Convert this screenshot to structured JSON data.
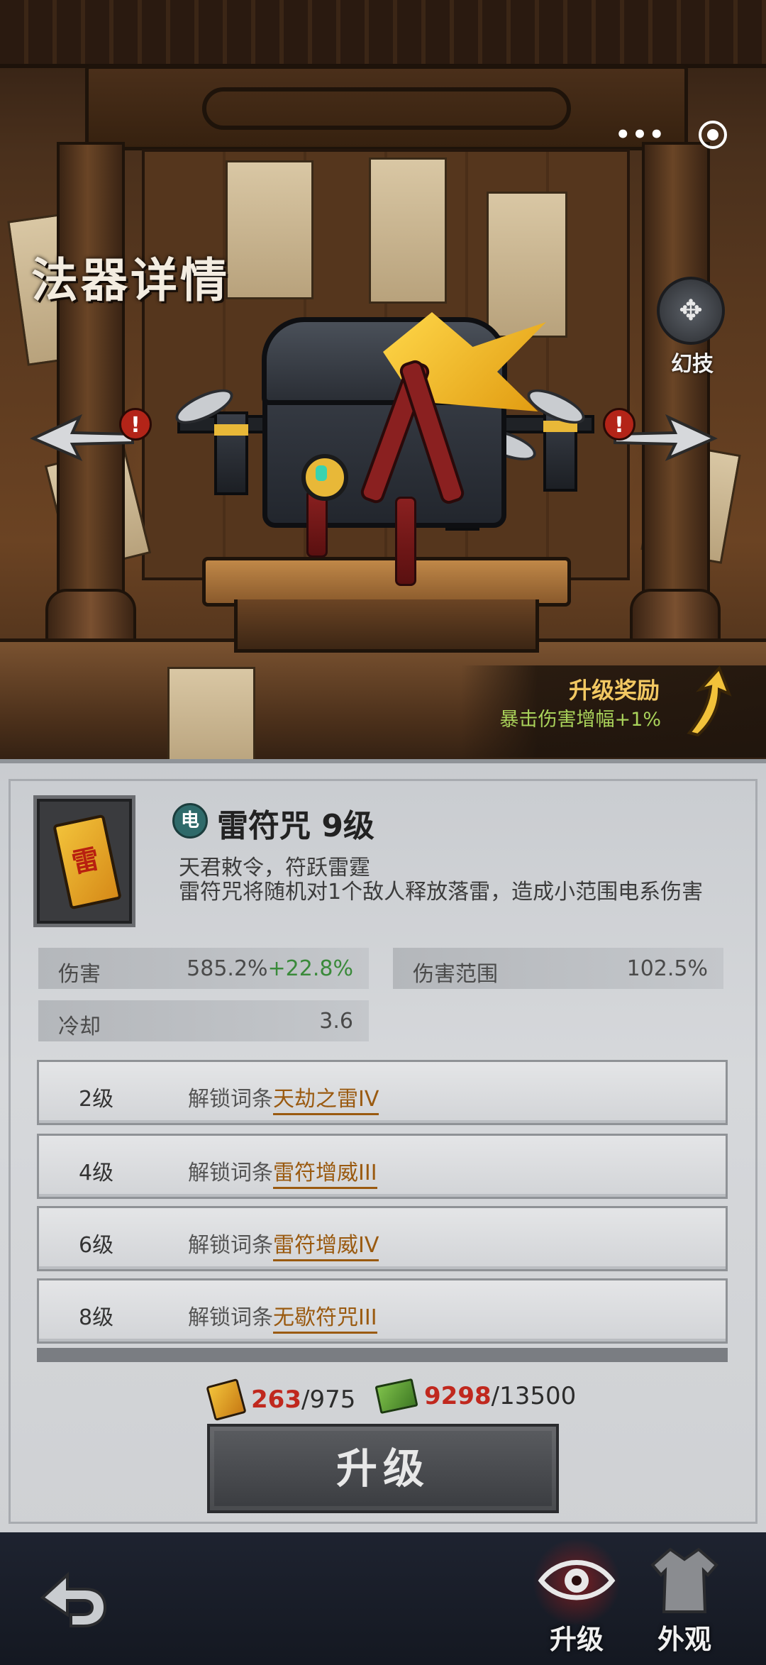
{
  "header": {
    "title": "法器详情",
    "menu_dots": "•••",
    "skin_skill_label": "幻技",
    "skin_skill_glyph": "✥"
  },
  "reward": {
    "title": "升级奖励",
    "desc": "暴击伤害增幅+1%"
  },
  "alert_glyph": "!",
  "item": {
    "element": "电",
    "name": "雷符咒 9级",
    "flavor": "天君敕令，符跃雷霆",
    "description": "雷符咒将随机对1个敌人释放落雷，造成小范围电系伤害"
  },
  "stats": {
    "damage_label": "伤害",
    "damage_value": "585.2%",
    "damage_bonus": "+22.8%",
    "range_label": "伤害范围",
    "range_value": "102.5%",
    "cooldown_label": "冷却",
    "cooldown_value": "3.6"
  },
  "unlocks": [
    {
      "level": "2级",
      "text": "解锁词条",
      "trait": "天劫之雷IV"
    },
    {
      "level": "4级",
      "text": "解锁词条",
      "trait": "雷符增威III"
    },
    {
      "level": "6级",
      "text": "解锁词条",
      "trait": "雷符增威IV"
    },
    {
      "level": "8级",
      "text": "解锁词条",
      "trait": "无歇符咒III"
    }
  ],
  "cost": {
    "fragments_have": "263",
    "fragments_need": "/975",
    "cash_have": "9298",
    "cash_need": "/13500"
  },
  "upgrade_button": "升级",
  "tabs": {
    "upgrade": "升级",
    "appearance": "外观"
  },
  "colors": {
    "accent_gold": "#f2c862",
    "bonus_green": "#3a8a3a",
    "cost_red": "#c0281e",
    "trait_brown": "#9a5a10"
  }
}
